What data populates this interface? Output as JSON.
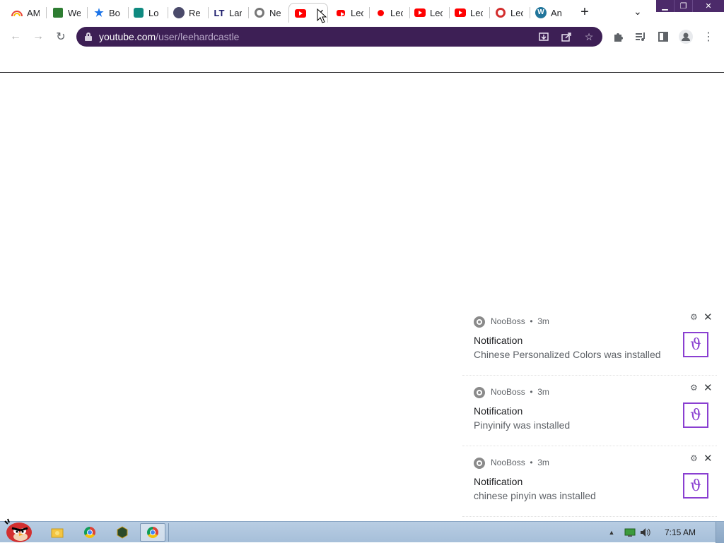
{
  "browser": {
    "tabs": [
      {
        "title": "AM",
        "icon": "rainbow-icon"
      },
      {
        "title": "We",
        "icon": "sheets-icon"
      },
      {
        "title": "Bo",
        "icon": "star-icon"
      },
      {
        "title": "Lo",
        "icon": "feather-icon"
      },
      {
        "title": "Re",
        "icon": "vue-icon"
      },
      {
        "title": "Lar",
        "icon": "lt-icon"
      },
      {
        "title": "Ne",
        "icon": "chrome-gray-icon"
      },
      {
        "title": "",
        "icon": "youtube-icon",
        "active": true
      },
      {
        "title": "Lec",
        "icon": "youtube-bubble-icon"
      },
      {
        "title": "Lec",
        "icon": "youtube-dot-icon"
      },
      {
        "title": "Lec",
        "icon": "youtube-icon"
      },
      {
        "title": "Lec",
        "icon": "youtube-icon"
      },
      {
        "title": "Lec",
        "icon": "red-circle-icon"
      },
      {
        "title": "An",
        "icon": "wordpress-icon"
      }
    ],
    "new_tab_symbol": "+",
    "tab_search_symbol": "⌄",
    "url_host": "youtube.com",
    "url_path": "/user/leehardcastle",
    "accent_color": "#3d1f55"
  },
  "notifications": [
    {
      "app": "NooBoss",
      "time": "3m",
      "title": "Notification",
      "message": "Chinese Personalized Colors was installed"
    },
    {
      "app": "NooBoss",
      "time": "3m",
      "title": "Notification",
      "message": "Pinyinify was installed"
    },
    {
      "app": "NooBoss",
      "time": "3m",
      "title": "Notification",
      "message": "chinese pinyin was installed"
    }
  ],
  "taskbar": {
    "time": "7:15 AM"
  }
}
